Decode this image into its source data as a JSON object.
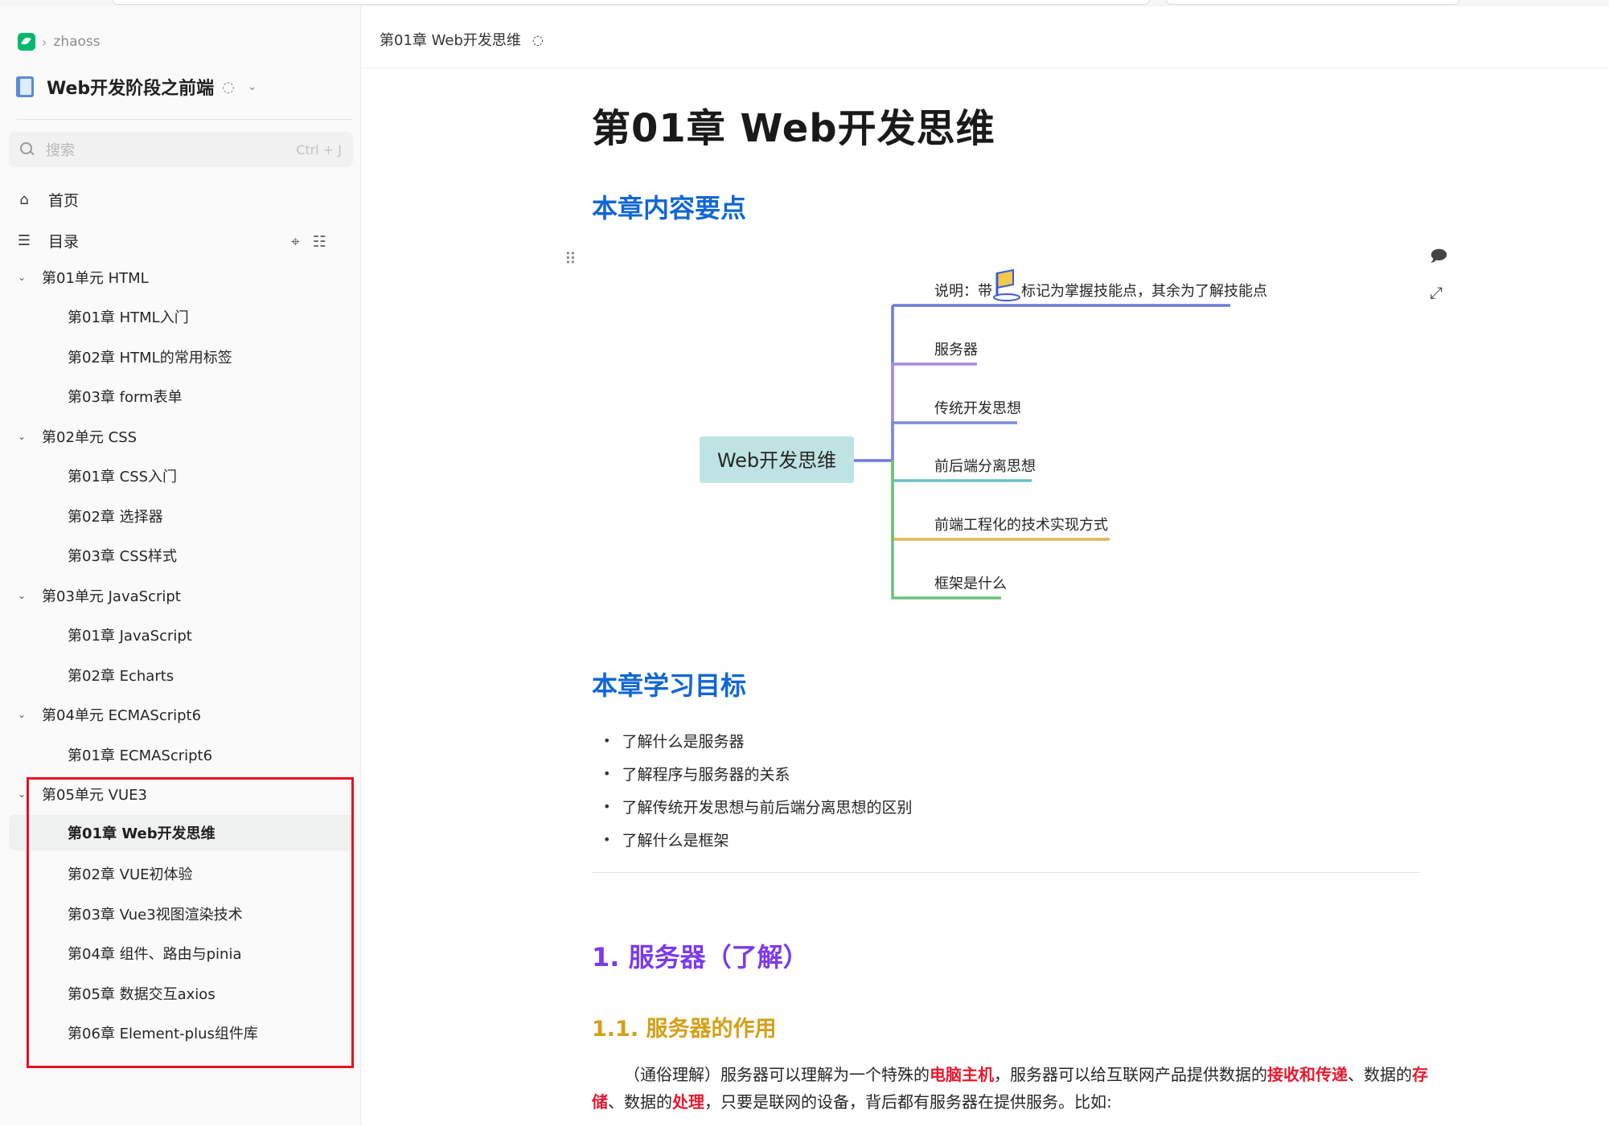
{
  "breadcrumb": {
    "user": "zhaoss"
  },
  "book": {
    "title": "Web开发阶段之前端"
  },
  "search": {
    "placeholder": "搜索",
    "shortcut": "Ctrl + J"
  },
  "nav": {
    "home": "首页",
    "toc": "目录"
  },
  "tree": {
    "units": [
      {
        "label": "第01单元 HTML",
        "docs": [
          "第01章 HTML入门",
          "第02章 HTML的常用标签",
          "第03章 form表单"
        ]
      },
      {
        "label": "第02单元 CSS",
        "docs": [
          "第01章 CSS入门",
          "第02章 选择器",
          "第03章 CSS样式"
        ]
      },
      {
        "label": "第03单元 JavaScript",
        "docs": [
          "第01章 JavaScript",
          "第02章 Echarts"
        ]
      },
      {
        "label": "第04单元 ECMAScript6",
        "docs": [
          "第01章 ECMAScript6"
        ]
      },
      {
        "label": "第05单元 VUE3",
        "docs": [
          "第01章 Web开发思维",
          "第02章 VUE初体验",
          "第03章 Vue3视图渲染技术",
          "第04章 组件、路由与pinia",
          "第05章 数据交互axios",
          "第06章 Element-plus组件库"
        ]
      }
    ]
  },
  "doc": {
    "header_title": "第01章 Web开发思维",
    "title": "第01章 Web开发思维",
    "section_points": "本章内容要点",
    "section_goals": "本章学习目标",
    "goals": [
      "了解什么是服务器",
      "了解程序与服务器的关系",
      "了解传统开发思想与前后端分离思想的区别",
      "了解什么是框架"
    ],
    "h2_server": "1. 服务器（了解）",
    "h3_role": "1.1. 服务器的作用",
    "para": {
      "p1": "（通俗理解）服务器可以理解为一个特殊的",
      "r1": "电脑主机",
      "p2": "，服务器可以给互联网产品提供数据的",
      "r2": "接收和传递",
      "p3": "、数据的",
      "r3": "存储",
      "p4": "、数据的",
      "r4": "处理",
      "p5": "，只要是联网的设备，背后都有服务器在提供服务。比如:"
    }
  },
  "mindmap": {
    "root": "Web开发思维",
    "note_prefix": "说明：带",
    "note_suffix": "标记为掌握技能点，其余为了解技能点",
    "branches": [
      "服务器",
      "传统开发思想",
      "前后端分离思想",
      "前端工程化的技术实现方式",
      "框架是什么"
    ],
    "colors": [
      "#6b7bd8",
      "#a78bd8",
      "#7b8ce0",
      "#66c2c2",
      "#e0b556",
      "#6cc07a"
    ]
  }
}
